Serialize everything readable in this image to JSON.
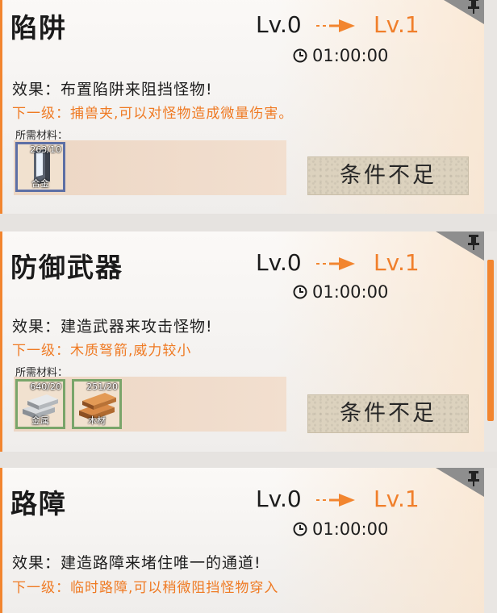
{
  "cards": [
    {
      "title": "陷阱",
      "level_current": "Lv.0",
      "level_next": "Lv.1",
      "timer": "01:00:00",
      "effect": "效果：布置陷阱来阻挡怪物!",
      "next_level": "下一级：捕兽夹,可以对怪物造成微量伤害。",
      "materials_label": "所需材料：",
      "materials": [
        {
          "name": "合金",
          "count": "263/10",
          "icon": "alloy-ingot-icon",
          "border": "blue"
        }
      ],
      "button": "条件不足"
    },
    {
      "title": "防御武器",
      "level_current": "Lv.0",
      "level_next": "Lv.1",
      "timer": "01:00:00",
      "effect": "效果：建造武器来攻击怪物!",
      "next_level": "下一级：木质弩箭,威力较小",
      "materials_label": "所需材料：",
      "materials": [
        {
          "name": "金属",
          "count": "640/20",
          "icon": "metal-bars-icon",
          "border": "green"
        },
        {
          "name": "木材",
          "count": "251/20",
          "icon": "wood-planks-icon",
          "border": "green"
        }
      ],
      "button": "条件不足"
    },
    {
      "title": "路障",
      "level_current": "Lv.0",
      "level_next": "Lv.1",
      "timer": "01:00:00",
      "effect": "效果：建造路障来堵住唯一的通道!",
      "next_level": "下一级：临时路障,可以稍微阻挡怪物穿入"
    }
  ],
  "colors": {
    "accent": "#f2852f",
    "level_next": "#f07f2b",
    "material_blue": "#5d6fa5",
    "material_green": "#79a56a"
  }
}
